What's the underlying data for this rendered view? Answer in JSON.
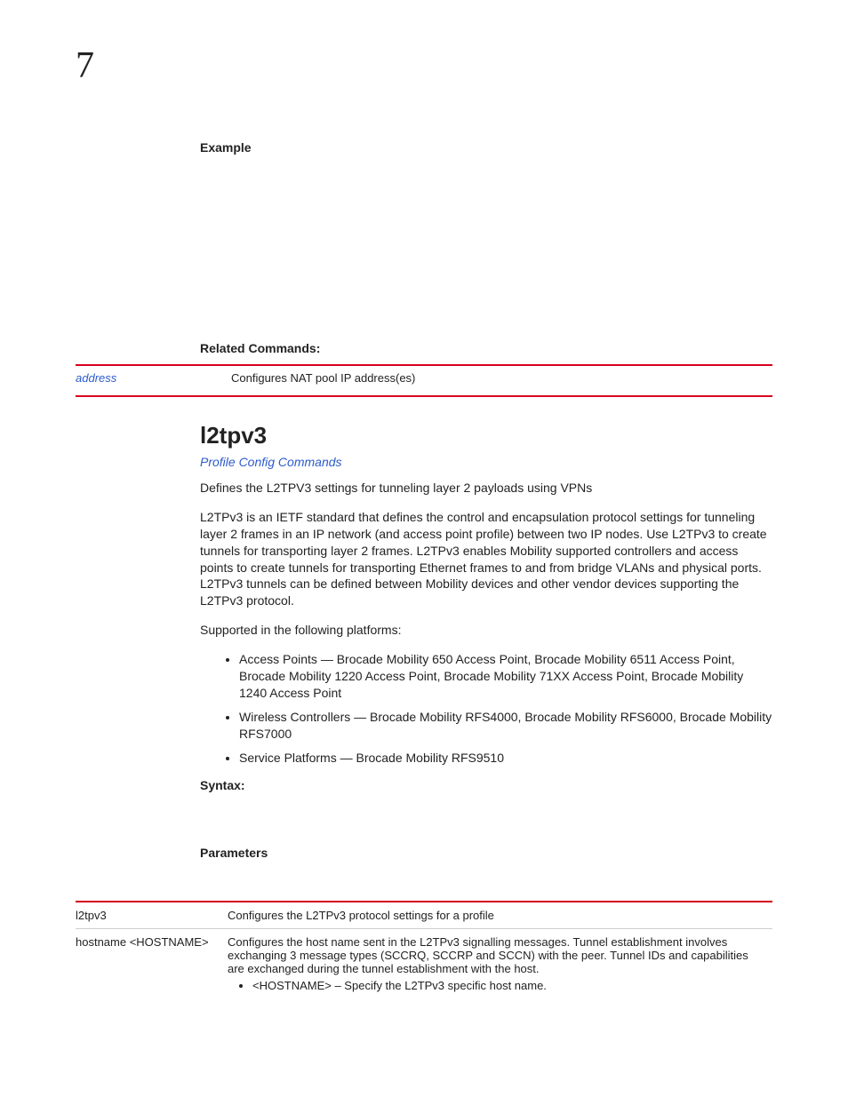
{
  "chapter_number": "7",
  "example_heading": "Example",
  "related_heading": "Related Commands:",
  "related_table": {
    "rows": [
      {
        "cmd": "address",
        "desc": "Configures NAT pool IP address(es)"
      }
    ]
  },
  "section_title": "l2tpv3",
  "section_link": "Profile Config Commands",
  "para1": "Defines the L2TPV3 settings for tunneling layer 2 payloads using VPNs",
  "para2": "L2TPv3 is an IETF standard that defines the control and encapsulation protocol settings for tunneling layer 2 frames in an IP network (and access point profile) between two IP nodes. Use L2TPv3 to create tunnels for transporting layer 2 frames. L2TPv3 enables Mobility supported controllers and access points to create tunnels for transporting Ethernet frames to and from bridge VLANs and physical ports. L2TPv3 tunnels can be defined between Mobility devices and other vendor devices supporting the L2TPv3 protocol.",
  "platforms_intro": "Supported in the following platforms:",
  "platforms": [
    "Access Points — Brocade Mobility 650 Access Point, Brocade Mobility 6511 Access Point, Brocade Mobility 1220 Access Point, Brocade Mobility 71XX Access Point, Brocade Mobility 1240 Access Point",
    "Wireless Controllers — Brocade Mobility RFS4000, Brocade Mobility RFS6000, Brocade Mobility RFS7000",
    "Service Platforms — Brocade Mobility RFS9510"
  ],
  "syntax_heading": "Syntax:",
  "parameters_heading": "Parameters",
  "params_table": {
    "rows": [
      {
        "key": "l2tpv3",
        "desc": "Configures the L2TPv3 protocol settings for a profile",
        "bullets": []
      },
      {
        "key": "hostname <HOSTNAME>",
        "desc": "Configures the host name sent in the L2TPv3 signalling messages. Tunnel establishment involves exchanging 3 message types (SCCRQ, SCCRP and SCCN) with the peer. Tunnel IDs and capabilities are exchanged during the tunnel establishment with the host.",
        "bullets": [
          "<HOSTNAME> – Specify the L2TPv3 specific host name."
        ]
      }
    ]
  }
}
